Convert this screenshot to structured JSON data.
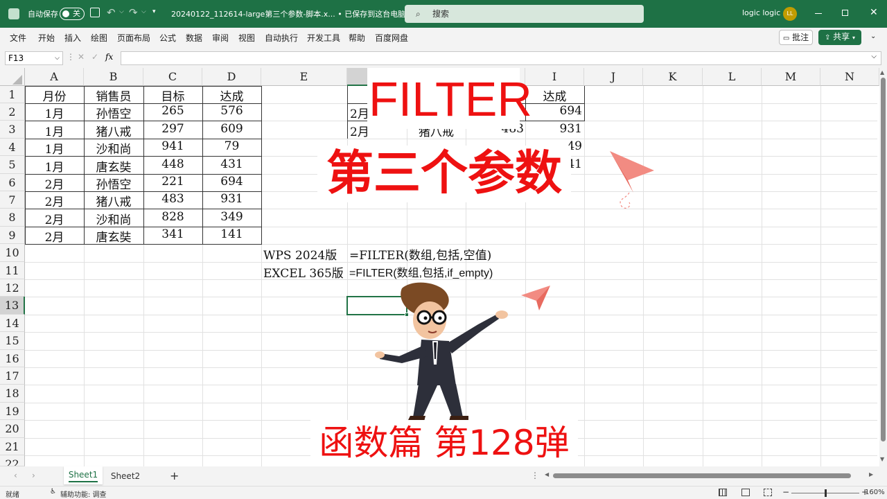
{
  "titlebar": {
    "autosave_label": "自动保存",
    "autosave_state": "关",
    "filename": "20240122_112614-large第三个参数-脚本.x... • 已保存到这台电脑",
    "search_placeholder": "搜索",
    "user_name": "logic logic",
    "user_initials": "LL"
  },
  "menu": {
    "items": [
      "文件",
      "开始",
      "插入",
      "绘图",
      "页面布局",
      "公式",
      "数据",
      "审阅",
      "视图",
      "自动执行",
      "开发工具",
      "帮助",
      "百度网盘"
    ],
    "comment_label": "批注",
    "share_label": "共享"
  },
  "formula_bar": {
    "name_box": "F13",
    "fx_label": "fx",
    "content": ""
  },
  "columns": [
    "A",
    "B",
    "C",
    "D",
    "E",
    "F",
    "G",
    "H",
    "I",
    "J",
    "K",
    "L",
    "M",
    "N"
  ],
  "rows": [
    "1",
    "2",
    "3",
    "4",
    "5",
    "6",
    "7",
    "8",
    "9",
    "10",
    "11",
    "12",
    "13",
    "14",
    "15",
    "16",
    "17",
    "18",
    "19",
    "20",
    "21",
    "22"
  ],
  "table_main": {
    "header": [
      "月份",
      "销售员",
      "目标",
      "达成"
    ],
    "rows": [
      [
        "1月",
        "孙悟空",
        "265",
        "576"
      ],
      [
        "1月",
        "猪八戒",
        "297",
        "609"
      ],
      [
        "1月",
        "沙和尚",
        "941",
        "79"
      ],
      [
        "1月",
        "唐玄奘",
        "448",
        "431"
      ],
      [
        "2月",
        "孙悟空",
        "221",
        "694"
      ],
      [
        "2月",
        "猪八戒",
        "483",
        "931"
      ],
      [
        "2月",
        "沙和尚",
        "828",
        "349"
      ],
      [
        "2月",
        "唐玄奘",
        "341",
        "141"
      ]
    ]
  },
  "table_result": {
    "header_i": "达成",
    "row2": {
      "f": "2月",
      "i": "694"
    },
    "row3": {
      "f": "2月",
      "g": "猪八戒",
      "h": "483",
      "i": "931"
    },
    "row4": {
      "i": "49"
    },
    "row5": {
      "i": "41"
    }
  },
  "notes": {
    "wps_label": "WPS 2024版",
    "wps_formula": "=FILTER(数组,包括,空值)",
    "excel_label": "EXCEL 365版",
    "excel_formula": "=FILTER(数组,包括,if_empty)"
  },
  "overlay": {
    "title": "FILTER",
    "subtitle": "第三个参数",
    "series": "函数篇 第128弹"
  },
  "sheet_tabs": [
    "Sheet1",
    "Sheet2"
  ],
  "status": {
    "ready": "就绪",
    "accessibility": "辅助功能: 调查",
    "zoom": "160%"
  },
  "colors": {
    "excel_green": "#1e7145",
    "overlay_red": "#ee1111",
    "selection_green": "#217346"
  }
}
